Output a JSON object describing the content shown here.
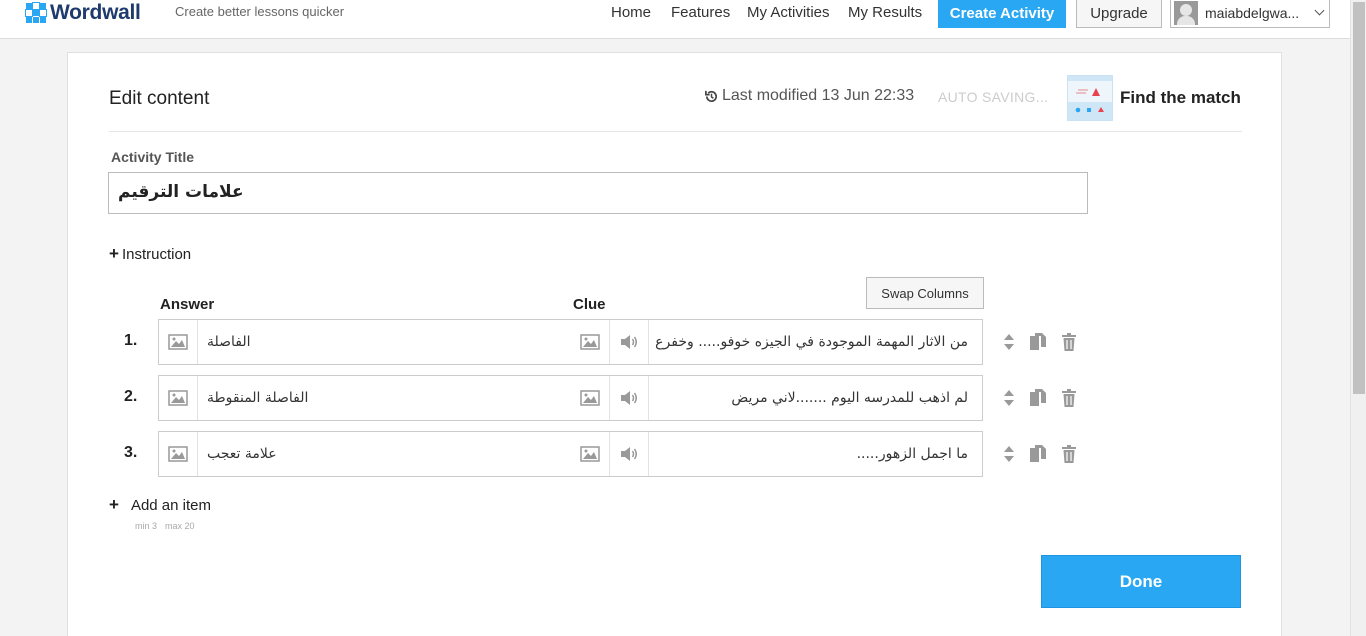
{
  "header": {
    "logo_text": "Wordwall",
    "tagline": "Create better lessons quicker",
    "nav": [
      "Home",
      "Features",
      "My Activities",
      "My Results"
    ],
    "create_label": "Create Activity",
    "upgrade_label": "Upgrade",
    "username": "maiabdelgwa..."
  },
  "editor": {
    "heading": "Edit content",
    "last_modified": "Last modified 13 Jun 22:33",
    "autosave": "AUTO SAVING...",
    "template_name": "Find the match",
    "title_label": "Activity Title",
    "title_value": "علامات الترقيم",
    "instruction_label": "Instruction",
    "answer_header": "Answer",
    "clue_header": "Clue",
    "swap_label": "Swap Columns",
    "rows": [
      {
        "num": "1.",
        "answer": "الفاصلة",
        "clue": "من الاثار المهمة الموجودة في الجيزه خوفو..... وخفرع"
      },
      {
        "num": "2.",
        "answer": "الفاصلة المنقوطة",
        "clue": "لم اذهب للمدرسه اليوم .......لاني مريض"
      },
      {
        "num": "3.",
        "answer": "علامة تعجب",
        "clue": "ما اجمل الزهور....."
      }
    ],
    "add_item_label": "Add an item",
    "min_label": "min 3",
    "max_label": "max 20",
    "done_label": "Done"
  },
  "colors": {
    "accent": "#2aa7f3",
    "brand_navy": "#1f3a6e"
  }
}
